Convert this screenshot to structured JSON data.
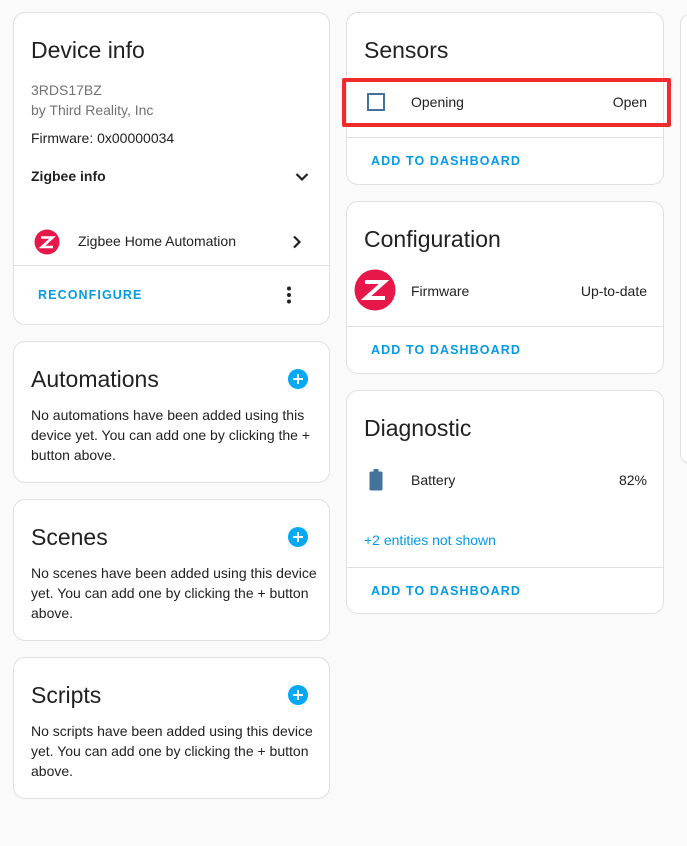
{
  "device_info": {
    "title": "Device info",
    "model": "3RDS17BZ",
    "manufacturer": "by Third Reality, Inc",
    "firmware": "Firmware: 0x00000034",
    "zigbee_info_label": "Zigbee info",
    "integration_label": "Zigbee Home Automation",
    "reconfigure_label": "RECONFIGURE"
  },
  "automations": {
    "title": "Automations",
    "empty_text": "No automations have been added using this device yet. You can add one by clicking the + button above."
  },
  "scenes": {
    "title": "Scenes",
    "empty_text": "No scenes have been added using this device yet. You can add one by clicking the + button above."
  },
  "scripts": {
    "title": "Scripts",
    "empty_text": "No scripts have been added using this device yet. You can add one by clicking the + button above."
  },
  "sensors": {
    "title": "Sensors",
    "entity_name": "Opening",
    "entity_state": "Open",
    "add_label": "ADD TO DASHBOARD"
  },
  "configuration": {
    "title": "Configuration",
    "entity_name": "Firmware",
    "entity_state": "Up-to-date",
    "add_label": "ADD TO DASHBOARD"
  },
  "diagnostic": {
    "title": "Diagnostic",
    "entity_name": "Battery",
    "entity_state": "82%",
    "hidden_entities": "+2 entities not shown",
    "add_label": "ADD TO DASHBOARD"
  },
  "colors": {
    "accent": "#03a9f4",
    "link": "#039be5",
    "zigbee_brand": "#e8174a",
    "highlight": "#ef2b2b"
  },
  "icons": {
    "integration": "zigbee-logo-icon",
    "expand": "chevron-down-icon",
    "navigate": "chevron-right-icon",
    "menu": "dots-vertical-icon",
    "add": "plus-circle-icon",
    "sensor": "checkbox-blank-outline-icon",
    "battery": "battery-icon"
  }
}
